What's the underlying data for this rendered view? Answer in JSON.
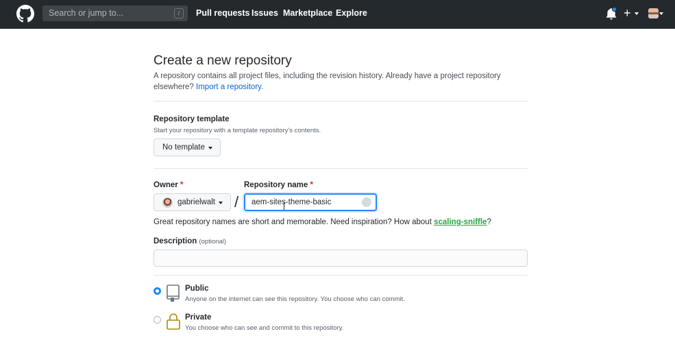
{
  "header": {
    "search_placeholder": "Search or jump to...",
    "search_shortcut": "/",
    "nav": [
      "Pull requests",
      "Issues",
      "Marketplace",
      "Explore"
    ],
    "plus_label": "+"
  },
  "page": {
    "title": "Create a new repository",
    "subtitle_text": "A repository contains all project files, including the revision history. Already have a project repository elsewhere?",
    "import_link": "Import a repository."
  },
  "template": {
    "label": "Repository template",
    "note": "Start your repository with a template repository's contents.",
    "button_label": "No template"
  },
  "owner": {
    "label": "Owner",
    "required_mark": "*",
    "value": "gabrielwalt"
  },
  "separator": "/",
  "repo_name": {
    "label": "Repository name",
    "required_mark": "*",
    "value": "aem-sites-theme-basic"
  },
  "hint": {
    "text": "Great repository names are short and memorable. Need inspiration? How about",
    "suggestion": "scaling-sniffle",
    "end": "?"
  },
  "description": {
    "label": "Description",
    "optional": "(optional)",
    "value": ""
  },
  "visibility": {
    "public": {
      "title": "Public",
      "desc": "Anyone on the internet can see this repository. You choose who can commit.",
      "selected": true
    },
    "private": {
      "title": "Private",
      "desc": "You choose who can see and commit to this repository.",
      "selected": false
    }
  },
  "colors": {
    "header_bg": "#24292e",
    "link": "#0366d6",
    "suggestion": "#28a745",
    "required": "#cb2431",
    "focus": "#2188ff"
  }
}
